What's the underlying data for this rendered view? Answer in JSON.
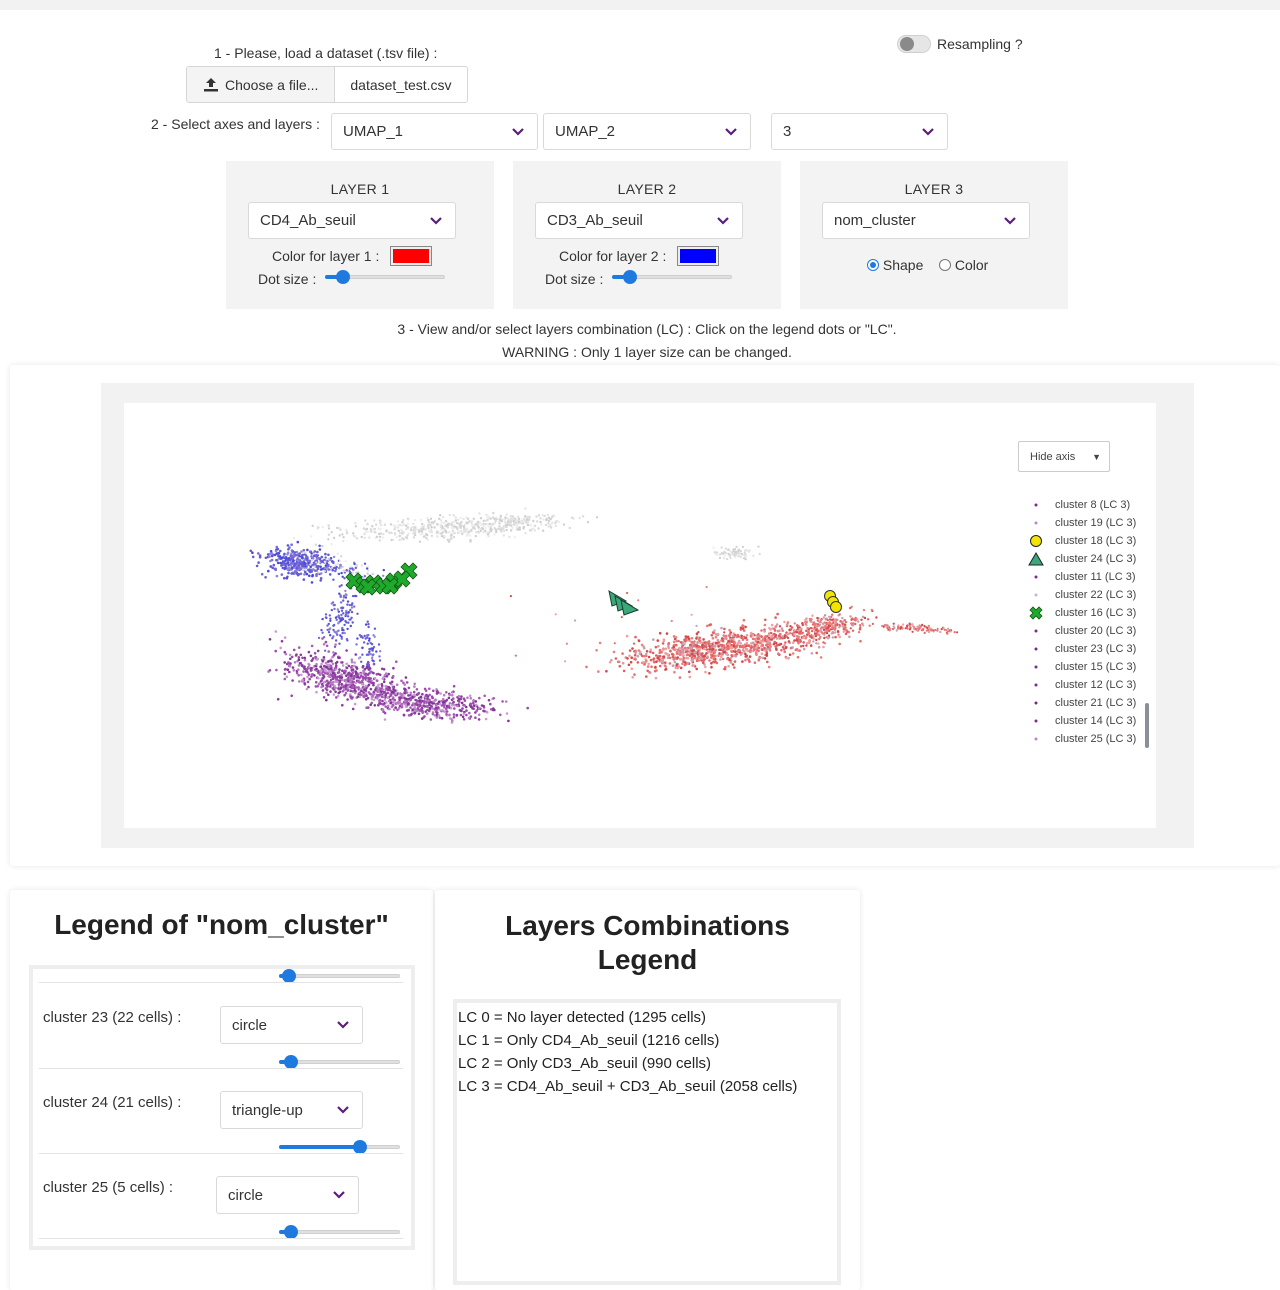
{
  "step1": {
    "label": "1 - Please, load a dataset (.tsv file) :",
    "choose_label": "Choose a file...",
    "file_name": "dataset_test.csv"
  },
  "resampling": {
    "label": "Resampling ?",
    "on": false
  },
  "step2": {
    "label": "2 - Select axes and layers :",
    "axis_x": "UMAP_1",
    "axis_y": "UMAP_2",
    "layers_count": "3"
  },
  "layer1": {
    "title": "LAYER 1",
    "variable": "CD4_Ab_seuil",
    "color_label": "Color for layer 1 :",
    "color": "#ff0000",
    "dot_size_label": "Dot size :",
    "dot_size_fraction": 0.15
  },
  "layer2": {
    "title": "LAYER 2",
    "variable": "CD3_Ab_seuil",
    "color_label": "Color for layer 2 :",
    "color": "#0000ff",
    "dot_size_label": "Dot size :",
    "dot_size_fraction": 0.15
  },
  "layer3": {
    "title": "LAYER 3",
    "variable": "nom_cluster",
    "option_shape": "Shape",
    "option_color": "Color",
    "selected": "Shape"
  },
  "step3": {
    "label": "3 - View and/or select layers combination (LC) : Click on the legend dots or \"LC\".",
    "warning": "WARNING : Only 1 layer size can be changed."
  },
  "plot": {
    "hide_axis_label": "Hide axis",
    "legend": [
      {
        "label": "cluster 8 (LC 3)",
        "marker": "dot",
        "color": "#7b2d8e"
      },
      {
        "label": "cluster 19 (LC 3)",
        "marker": "dot",
        "color": "#b48bc4"
      },
      {
        "label": "cluster 18 (LC 3)",
        "marker": "circle",
        "color": "#f2e600"
      },
      {
        "label": "cluster 24 (LC 3)",
        "marker": "triangle-up",
        "color": "#3aa87a"
      },
      {
        "label": "cluster 11 (LC 3)",
        "marker": "dot",
        "color": "#7b2d8e"
      },
      {
        "label": "cluster 22 (LC 3)",
        "marker": "dot",
        "color": "#c9b2d6"
      },
      {
        "label": "cluster 16 (LC 3)",
        "marker": "x",
        "color": "#1faa2e"
      },
      {
        "label": "cluster 20 (LC 3)",
        "marker": "dot",
        "color": "#7b2d8e"
      },
      {
        "label": "cluster 23 (LC 3)",
        "marker": "dot",
        "color": "#6a2d8e"
      },
      {
        "label": "cluster 15 (LC 3)",
        "marker": "dot",
        "color": "#7b2d8e"
      },
      {
        "label": "cluster 12 (LC 3)",
        "marker": "dot",
        "color": "#7b2d8e"
      },
      {
        "label": "cluster 21 (LC 3)",
        "marker": "dot",
        "color": "#6a2d8e"
      },
      {
        "label": "cluster 14 (LC 3)",
        "marker": "dot",
        "color": "#7b2d8e"
      },
      {
        "label": "cluster 25 (LC 3)",
        "marker": "dot",
        "color": "#b48bc4"
      }
    ]
  },
  "legend_card": {
    "title": "Legend of \"nom_cluster\"",
    "top_slider_fraction": 0.08,
    "items": [
      {
        "label": "cluster 23 (22 cells) :",
        "shape": "circle",
        "size_fraction": 0.1
      },
      {
        "label": "cluster 24 (21 cells) :",
        "shape": "triangle-up",
        "size_fraction": 0.67
      },
      {
        "label": "cluster 25 (5 cells) :",
        "shape": "circle",
        "size_fraction": 0.1
      }
    ]
  },
  "lc_card": {
    "title_line1": "Layers Combinations",
    "title_line2": "Legend",
    "lines": [
      "LC 0 = No layer detected (1295 cells)",
      "LC 1 = Only CD4_Ab_seuil (1216 cells)",
      "LC 2 = Only CD3_Ab_seuil (990 cells)",
      "LC 3 = CD4_Ab_seuil + CD3_Ab_seuil (2058 cells)"
    ]
  }
}
